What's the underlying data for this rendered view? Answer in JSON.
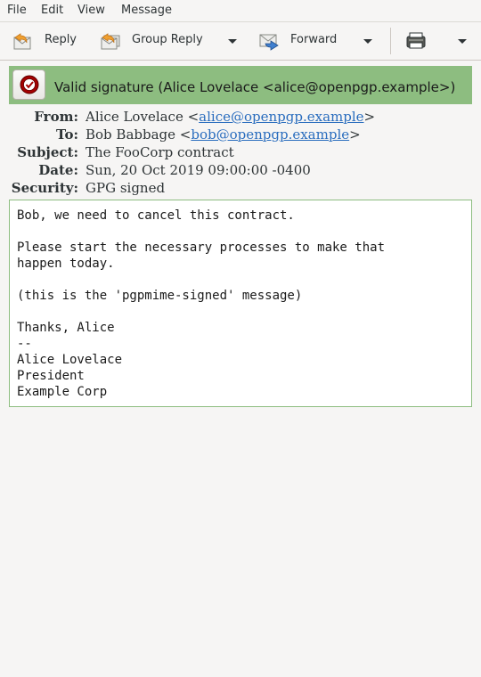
{
  "menubar": {
    "items": [
      {
        "label": "File"
      },
      {
        "label": "Edit"
      },
      {
        "label": "View"
      },
      {
        "label": "Message"
      }
    ]
  },
  "toolbar": {
    "reply_label": "Reply",
    "group_reply_label": "Group Reply",
    "forward_label": "Forward",
    "reply_icon": "reply-icon",
    "group_reply_icon": "group-reply-icon",
    "forward_icon": "forward-icon",
    "print_icon": "print-icon"
  },
  "signature": {
    "text": "Valid signature (Alice Lovelace <alice@openpgp.example>)",
    "status_color": "#8dbd80",
    "icon": "signature-valid-icon"
  },
  "headers": {
    "from_label": "From:",
    "from_name": "Alice Lovelace <",
    "from_email": "alice@openpgp.example",
    "from_close": ">",
    "to_label": "To:",
    "to_name": "Bob Babbage <",
    "to_email": "bob@openpgp.example",
    "to_close": ">",
    "subject_label": "Subject:",
    "subject_value": "The FooCorp contract",
    "date_label": "Date:",
    "date_value": "Sun, 20 Oct 2019 09:00:00 -0400",
    "security_label": "Security:",
    "security_value": "GPG signed",
    "link_color": "#2a6dbe"
  },
  "message": {
    "body": "Bob, we need to cancel this contract.\n\nPlease start the necessary processes to make that\nhappen today.\n\n(this is the 'pgpmime-signed' message)\n\nThanks, Alice\n--\nAlice Lovelace\nPresident\nExample Corp"
  }
}
